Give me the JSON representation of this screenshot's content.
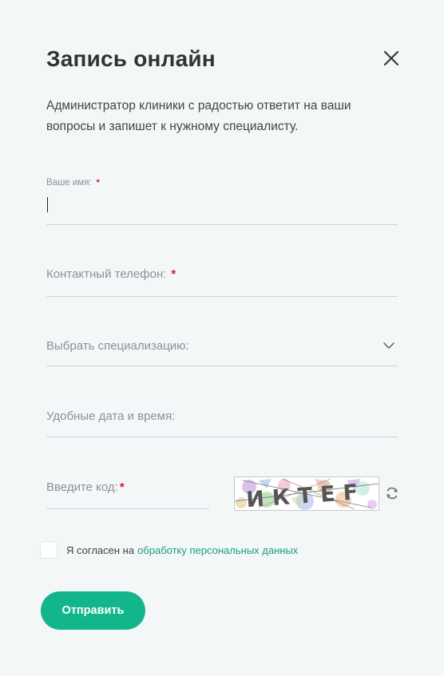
{
  "modal": {
    "title": "Запись онлайн",
    "description": "Администратор клиники с радостью ответит на ваши вопросы и запишет к нужному специалисту."
  },
  "form": {
    "name_label": "Ваше имя:",
    "phone_label": "Контактный телефон:",
    "specialization_label": "Выбрать специализацию:",
    "datetime_label": "Удобные дата и время:",
    "code_label": "Введите код:",
    "required_mark": "*",
    "captcha_text": "ИКТЕF"
  },
  "consent": {
    "text": "Я согласен на",
    "link": "обработку персональных данных",
    "checked": false
  },
  "submit_label": "Отправить",
  "colors": {
    "accent": "#13b68a",
    "link": "#1b9e7f",
    "required": "#cc1f1f",
    "background": "#f4f7f8"
  },
  "icons": {
    "close": "close-icon",
    "dropdown": "chevron-down-icon",
    "refresh": "refresh-icon"
  }
}
